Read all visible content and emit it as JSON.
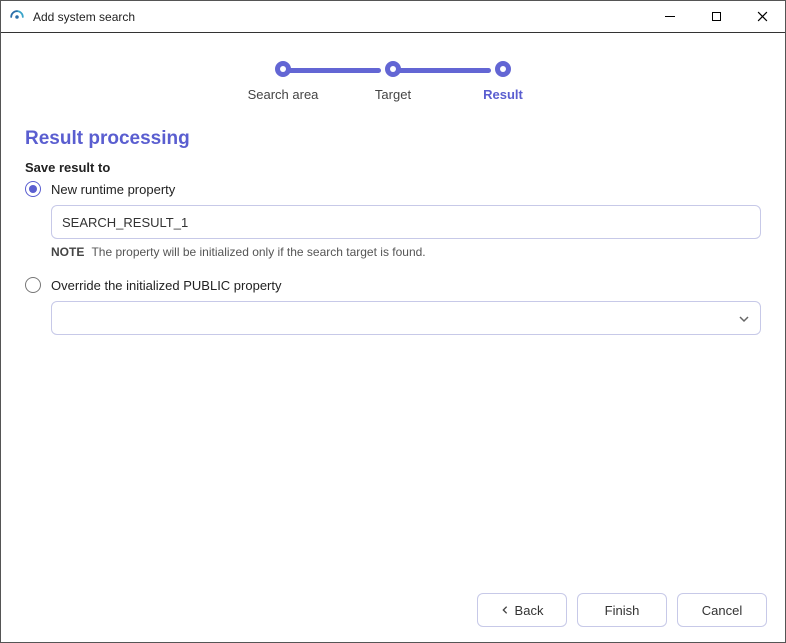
{
  "window": {
    "title": "Add system search"
  },
  "stepper": {
    "steps": [
      "Search area",
      "Target",
      "Result"
    ],
    "activeIndex": 2
  },
  "page": {
    "heading": "Result processing",
    "saveLabel": "Save result to",
    "option1": {
      "label": "New runtime property",
      "value": "SEARCH_RESULT_1",
      "noteTag": "NOTE",
      "noteText": "The property will be initialized only if the search target is found."
    },
    "option2": {
      "label": "Override the initialized PUBLIC property",
      "selectValue": ""
    }
  },
  "footer": {
    "back": "Back",
    "finish": "Finish",
    "cancel": "Cancel"
  }
}
